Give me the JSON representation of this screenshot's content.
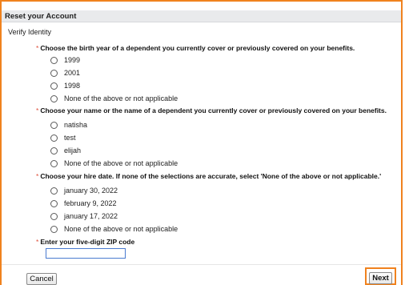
{
  "window": {
    "title": "Reset your Account"
  },
  "section": {
    "title": "Verify Identity"
  },
  "questions": [
    {
      "label": "Choose the birth year of a dependent you currently cover or previously covered on your benefits.",
      "options": [
        "1999",
        "2001",
        "1998",
        "None of the above or not applicable"
      ]
    },
    {
      "label": "Choose your name or the name of a dependent you currently cover or previously covered on your benefits.",
      "options": [
        "natisha",
        "test",
        "elijah",
        "None of the above or not applicable"
      ]
    },
    {
      "label": "Choose your hire date. If none of the selections are accurate, select 'None of the above or not applicable.'",
      "options": [
        "january 30, 2022",
        "february 9, 2022",
        "january 17, 2022",
        "None of the above or not applicable"
      ]
    }
  ],
  "zip": {
    "label": "Enter your five-digit ZIP code",
    "value": ""
  },
  "required_marker": "*",
  "buttons": {
    "cancel": "Cancel",
    "next": "Next"
  },
  "colors": {
    "highlight": "#f0821e",
    "required": "#e0503c",
    "titlebar_bg": "#e9eaec"
  }
}
